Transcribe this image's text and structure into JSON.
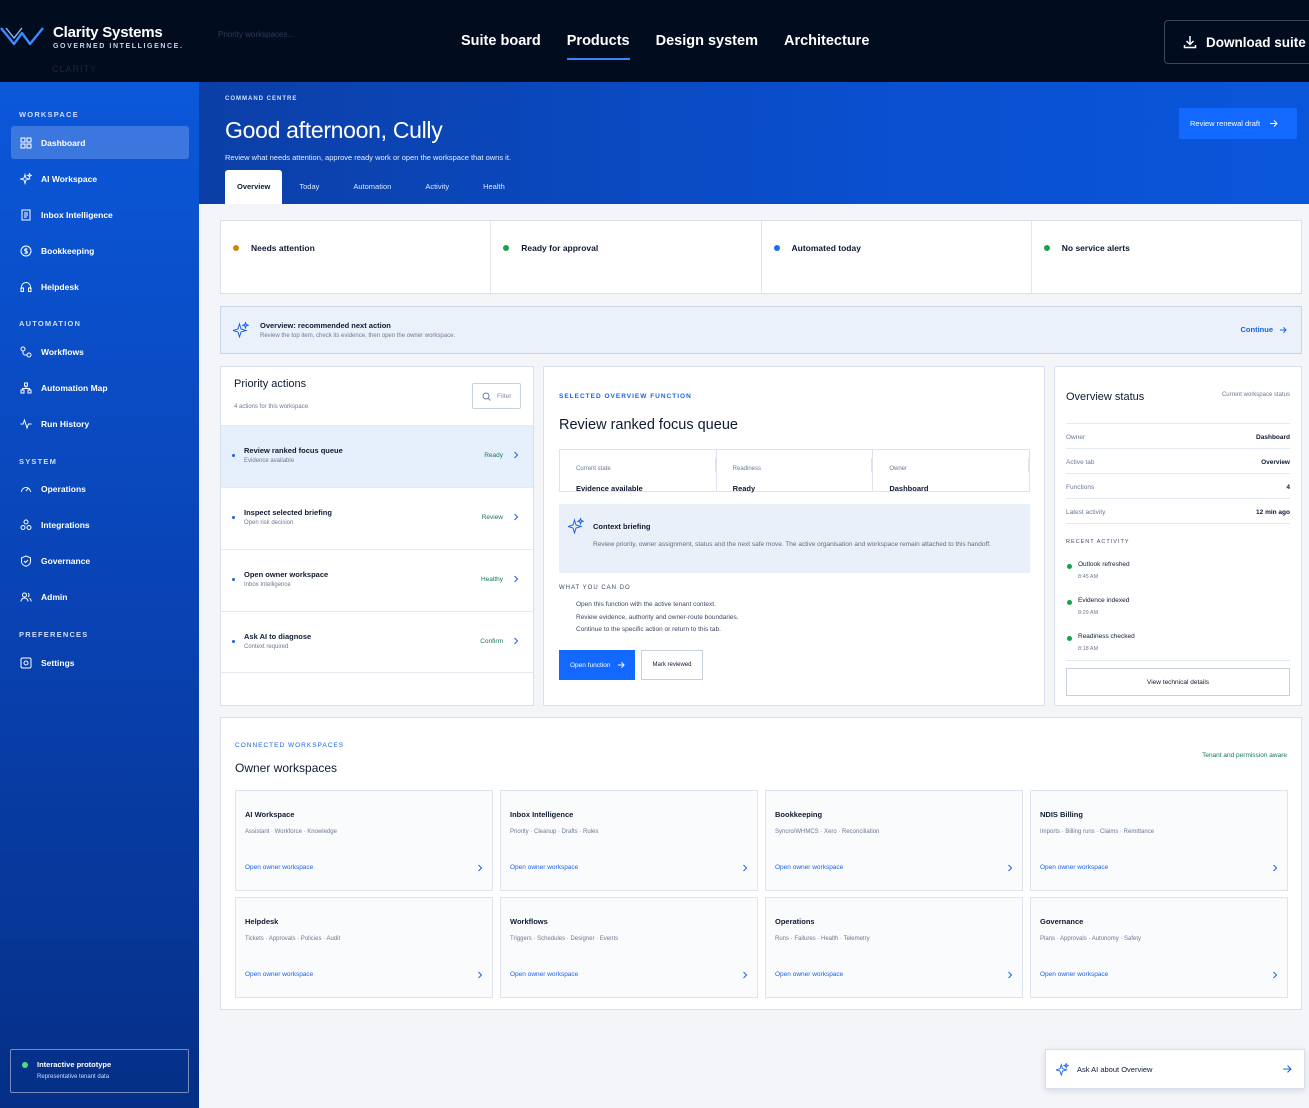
{
  "colors": {
    "accent": "#1268ff",
    "sidebar": "#0a4fcf",
    "topbar": "#020c1f",
    "status_amber": "#c98a0c",
    "status_green": "#16a34a",
    "status_blue": "#1d6cf0"
  },
  "brand": {
    "name": "Clarity Systems",
    "tagline": "GOVERNED INTELLIGENCE.",
    "ghost_search": "Priority workspaces...",
    "ghost_faint": "CLARITY"
  },
  "topnav": {
    "items": [
      "Suite board",
      "Products",
      "Design system",
      "Architecture"
    ],
    "active": "Products",
    "download": "Download suite"
  },
  "sidebar": {
    "sections": [
      {
        "label": "WORKSPACE",
        "items": [
          {
            "label": "Dashboard",
            "icon": "grid-icon"
          },
          {
            "label": "AI Workspace",
            "icon": "sparkles-icon"
          },
          {
            "label": "Inbox Intelligence",
            "icon": "document-icon"
          },
          {
            "label": "Bookkeeping",
            "icon": "dollar-icon"
          },
          {
            "label": "Helpdesk",
            "icon": "headset-icon"
          }
        ]
      },
      {
        "label": "AUTOMATION",
        "items": [
          {
            "label": "Workflows",
            "icon": "workflow-icon"
          },
          {
            "label": "Automation Map",
            "icon": "nodes-icon"
          },
          {
            "label": "Run History",
            "icon": "activity-icon"
          }
        ]
      },
      {
        "label": "SYSTEM",
        "items": [
          {
            "label": "Operations",
            "icon": "gauge-icon"
          },
          {
            "label": "Integrations",
            "icon": "puzzle-icon"
          },
          {
            "label": "Governance",
            "icon": "shield-icon"
          },
          {
            "label": "Admin",
            "icon": "users-icon"
          }
        ]
      },
      {
        "label": "PREFERENCES",
        "items": [
          {
            "label": "Settings",
            "icon": "settings-icon"
          }
        ]
      }
    ],
    "active": "Dashboard",
    "prototype": {
      "title": "Interactive prototype",
      "subtitle": "Representative tenant data"
    }
  },
  "hero": {
    "eyebrow": "COMMAND CENTRE",
    "greeting": "Good afternoon, Cully",
    "subtitle": "Review what needs attention, approve ready work or open the workspace that owns it.",
    "tabs": [
      "Overview",
      "Today",
      "Automation",
      "Activity",
      "Health"
    ],
    "active_tab": "Overview",
    "renew_button": "Review renewal draft"
  },
  "status_strip": [
    {
      "label": "Needs attention",
      "color": "#c98a0c"
    },
    {
      "label": "Ready for approval",
      "color": "#16a34a"
    },
    {
      "label": "Automated today",
      "color": "#1d6cf0"
    },
    {
      "label": "No service alerts",
      "color": "#16a34a"
    }
  ],
  "recommendation": {
    "title": "Overview: recommended next action",
    "subtitle": "Review the top item, check its evidence, then open the owner workspace.",
    "action": "Continue"
  },
  "priority": {
    "title": "Priority actions",
    "count": "4 actions for this workspace",
    "filter": "Filter",
    "items": [
      {
        "title": "Review ranked focus queue",
        "sub": "Evidence available",
        "status": "Ready",
        "selected": true
      },
      {
        "title": "Inspect selected briefing",
        "sub": "Open risk decision",
        "status": "Review",
        "selected": false
      },
      {
        "title": "Open owner workspace",
        "sub": "Inbox Intelligence",
        "status": "Healthy",
        "selected": false
      },
      {
        "title": "Ask AI to diagnose",
        "sub": "Context required",
        "status": "Confirm",
        "selected": false
      }
    ]
  },
  "selected": {
    "eyebrow": "SELECTED OVERVIEW FUNCTION",
    "title": "Review ranked focus queue",
    "fields": [
      {
        "k": "Current state",
        "v": "Evidence available"
      },
      {
        "k": "Readiness",
        "v": "Ready"
      },
      {
        "k": "Owner",
        "v": "Dashboard"
      }
    ],
    "briefing_title": "Context briefing",
    "briefing_body": "Review priority, owner assignment, status and the next safe move. The active organisation and workspace remain attached to this handoff.",
    "can_do_label": "WHAT YOU CAN DO",
    "can_do": [
      "Open this function with the active tenant context.",
      "Review evidence, authority and owner-route boundaries.",
      "Continue to the specific action or return to this tab."
    ],
    "open_button": "Open function",
    "mark_button": "Mark reviewed"
  },
  "overview_status": {
    "title": "Overview status",
    "caption": "Current workspace status",
    "rows": [
      {
        "k": "Owner",
        "v": "Dashboard"
      },
      {
        "k": "Active tab",
        "v": "Overview"
      },
      {
        "k": "Functions",
        "v": "4"
      },
      {
        "k": "Latest activity",
        "v": "12 min ago"
      }
    ],
    "recent_label": "RECENT ACTIVITY",
    "recent": [
      {
        "title": "Outlook refreshed",
        "time": "8:45 AM"
      },
      {
        "title": "Evidence indexed",
        "time": "8:29 AM"
      },
      {
        "title": "Readiness checked",
        "time": "8:18 AM"
      }
    ],
    "details_button": "View technical details"
  },
  "workspaces": {
    "eyebrow": "CONNECTED WORKSPACES",
    "title": "Owner workspaces",
    "aware": "Tenant and permission aware",
    "link": "Open owner workspace",
    "cards": [
      {
        "title": "AI Workspace",
        "desc": "Assistant · Workforce · Knowledge"
      },
      {
        "title": "Inbox Intelligence",
        "desc": "Priority · Cleanup · Drafts · Rules"
      },
      {
        "title": "Bookkeeping",
        "desc": "Syncro/WHMCS · Xero · Reconciliation"
      },
      {
        "title": "NDIS Billing",
        "desc": "Imports · Billing runs · Claims · Remittance"
      },
      {
        "title": "Helpdesk",
        "desc": "Tickets · Approvals · Policies · Audit"
      },
      {
        "title": "Workflows",
        "desc": "Triggers · Schedules · Designer · Events"
      },
      {
        "title": "Operations",
        "desc": "Runs · Failures · Health · Telemetry"
      },
      {
        "title": "Governance",
        "desc": "Plans · Approvals · Autonomy · Safety"
      }
    ]
  },
  "ask_ai": "Ask AI about Overview"
}
